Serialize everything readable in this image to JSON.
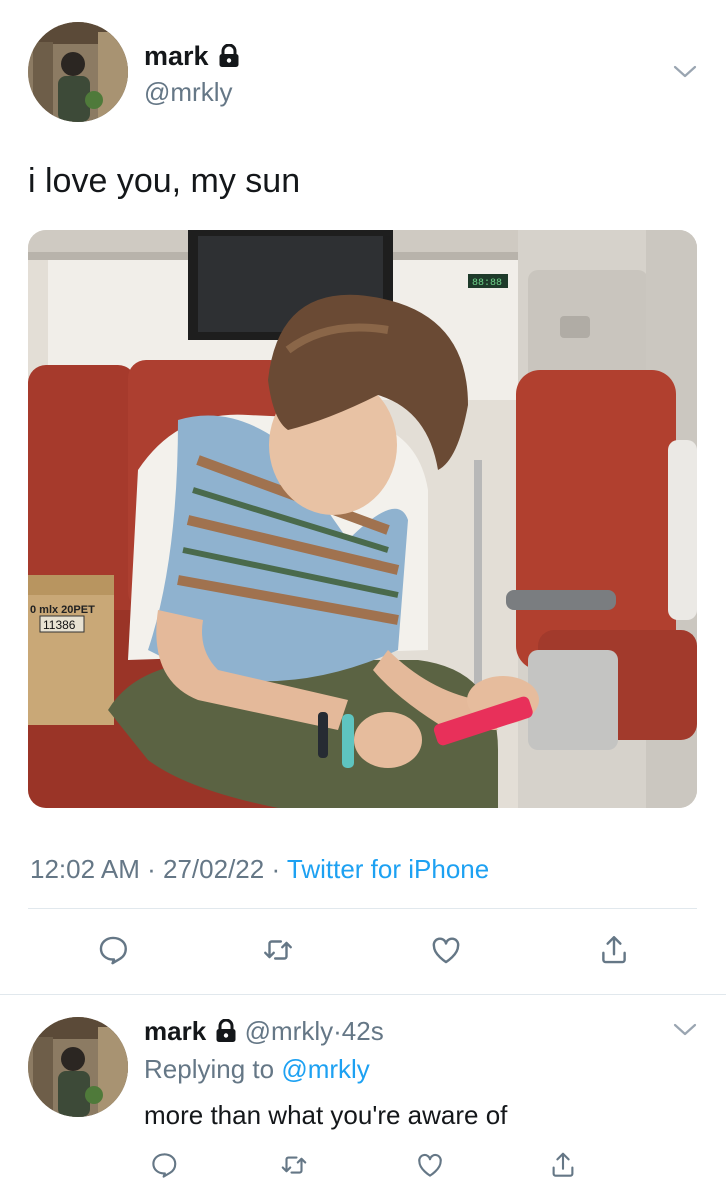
{
  "tweet": {
    "author_name": "mark",
    "author_handle": "@mrkly",
    "text": "i love you, my sun",
    "timestamp": "12:02 AM",
    "date": "27/02/22",
    "source": "Twitter for iPhone",
    "separator": "·",
    "photo_box_text": "0 mlx 20PET",
    "photo_box_number": "11386",
    "photo_display": "88:88"
  },
  "reply": {
    "author_name": "mark",
    "author_handle": "@mrkly",
    "age": "42s",
    "separator": "·",
    "replying_prefix": "Replying to",
    "replying_handle": "@mrkly",
    "text": "more than what you're aware of"
  },
  "icons": {
    "lock": "lock-icon",
    "menu": "chevron-down-icon",
    "reply": "reply-icon",
    "retweet": "retweet-icon",
    "like": "heart-icon",
    "share": "share-icon"
  },
  "colors": {
    "link": "#1da1f2",
    "muted": "#657786",
    "text": "#14171a",
    "divider": "#e1e8ed"
  }
}
